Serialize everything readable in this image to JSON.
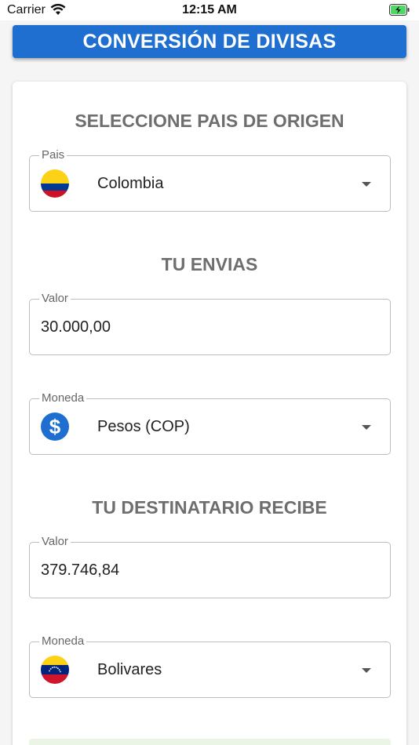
{
  "status_bar": {
    "carrier": "Carrier",
    "time": "12:15 AM"
  },
  "header": {
    "title": "CONVERSIÓN DE DIVISAS"
  },
  "origin": {
    "section_title": "SELECCIONE PAIS DE ORIGEN",
    "country_label": "Pais",
    "country_value": "Colombia",
    "flag_icon": "colombia-flag-icon"
  },
  "send": {
    "section_title": "TU ENVIAS",
    "amount_label": "Valor",
    "amount_value": "30.000,00",
    "currency_label": "Moneda",
    "currency_value": "Pesos (COP)",
    "currency_icon": "dollar-icon"
  },
  "receive": {
    "section_title": "TU DESTINATARIO RECIBE",
    "amount_label": "Valor",
    "amount_value": "379.746,84",
    "currency_label": "Moneda",
    "currency_value": "Bolivares",
    "flag_icon": "venezuela-flag-icon"
  },
  "colors": {
    "primary": "#1e6fd0",
    "section_title": "#6e6e6e",
    "border": "#bdbdbd"
  }
}
